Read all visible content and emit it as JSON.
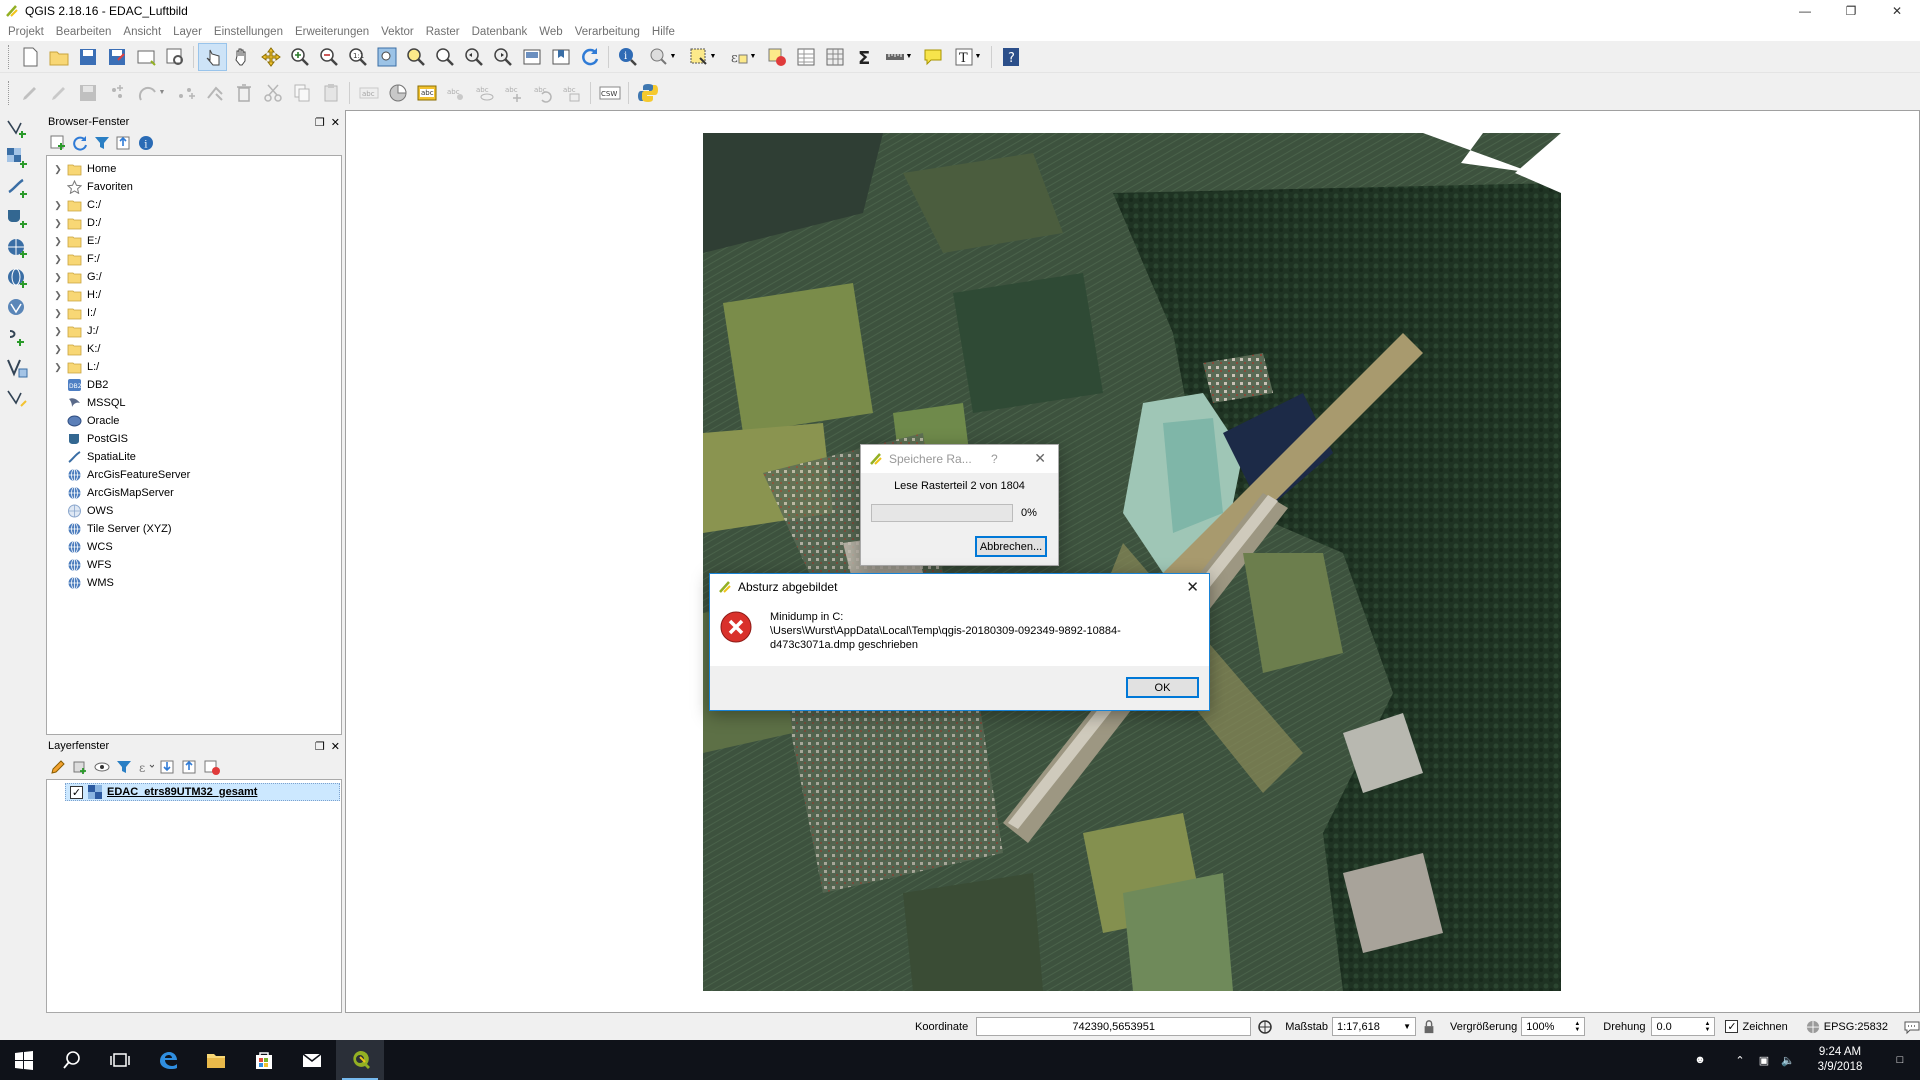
{
  "window": {
    "title": "QGIS 2.18.16 - EDAC_Luftbild"
  },
  "menu": [
    "Projekt",
    "Bearbeiten",
    "Ansicht",
    "Layer",
    "Einstellungen",
    "Erweiterungen",
    "Vektor",
    "Raster",
    "Datenbank",
    "Web",
    "Verarbeitung",
    "Hilfe"
  ],
  "browser_panel": {
    "title": "Browser-Fenster",
    "items": [
      {
        "label": "Home",
        "icon": "folder-icon",
        "expandable": true
      },
      {
        "label": "Favoriten",
        "icon": "star-icon",
        "expandable": false
      },
      {
        "label": "C:/",
        "icon": "folder-icon",
        "expandable": true
      },
      {
        "label": "D:/",
        "icon": "folder-icon",
        "expandable": true
      },
      {
        "label": "E:/",
        "icon": "folder-icon",
        "expandable": true
      },
      {
        "label": "F:/",
        "icon": "folder-icon",
        "expandable": true
      },
      {
        "label": "G:/",
        "icon": "folder-icon",
        "expandable": true
      },
      {
        "label": "H:/",
        "icon": "folder-icon",
        "expandable": true
      },
      {
        "label": "I:/",
        "icon": "folder-icon",
        "expandable": true
      },
      {
        "label": "J:/",
        "icon": "folder-icon",
        "expandable": true
      },
      {
        "label": "K:/",
        "icon": "folder-icon",
        "expandable": true
      },
      {
        "label": "L:/",
        "icon": "folder-icon",
        "expandable": true
      },
      {
        "label": "DB2",
        "icon": "db2-icon",
        "expandable": false
      },
      {
        "label": "MSSQL",
        "icon": "mssql-icon",
        "expandable": false
      },
      {
        "label": "Oracle",
        "icon": "oracle-icon",
        "expandable": false
      },
      {
        "label": "PostGIS",
        "icon": "postgis-icon",
        "expandable": false
      },
      {
        "label": "SpatiaLite",
        "icon": "spatialite-icon",
        "expandable": false
      },
      {
        "label": "ArcGisFeatureServer",
        "icon": "globe-icon",
        "expandable": false
      },
      {
        "label": "ArcGisMapServer",
        "icon": "globe-icon",
        "expandable": false
      },
      {
        "label": "OWS",
        "icon": "ows-icon",
        "expandable": false
      },
      {
        "label": "Tile Server (XYZ)",
        "icon": "globe-icon",
        "expandable": false
      },
      {
        "label": "WCS",
        "icon": "globe-icon",
        "expandable": false
      },
      {
        "label": "WFS",
        "icon": "globe-icon",
        "expandable": false
      },
      {
        "label": "WMS",
        "icon": "globe-icon",
        "expandable": false
      }
    ]
  },
  "layer_panel": {
    "title": "Layerfenster",
    "layers": [
      {
        "name": "EDAC_etrs89UTM32_gesamt",
        "checked": true
      }
    ]
  },
  "progress_dialog": {
    "title": "Speichere Ra...",
    "help": "?",
    "message": "Lese Rasterteil 2 von 1804",
    "progress_percent": 0,
    "progress_label": "0%",
    "cancel_label": "Abbrechen..."
  },
  "crash_dialog": {
    "title": "Absturz abgebildet",
    "message_line1": "Minidump in C:",
    "message_line2": "\\Users\\Wurst\\AppData\\Local\\Temp\\qgis-20180309-092349-9892-10884-",
    "message_line3": "d473c3071a.dmp geschrieben",
    "ok_label": "OK"
  },
  "statusbar": {
    "coord_label": "Koordinate",
    "coord_value": "742390,5653951",
    "scale_label": "Maßstab",
    "scale_value": "1:17,618",
    "zoom_label": "Vergrößerung",
    "zoom_value": "100%",
    "rotation_label": "Drehung",
    "rotation_value": "0.0",
    "render_label": "Zeichnen",
    "render_checked": true,
    "crs_label": "EPSG:25832"
  },
  "taskbar": {
    "time": "9:24 AM",
    "date": "3/9/2018"
  },
  "colors": {
    "accent": "#0078d7",
    "qgis_green": "#93b023",
    "taskbar": "#0f1219",
    "folder": "#f8d775"
  }
}
